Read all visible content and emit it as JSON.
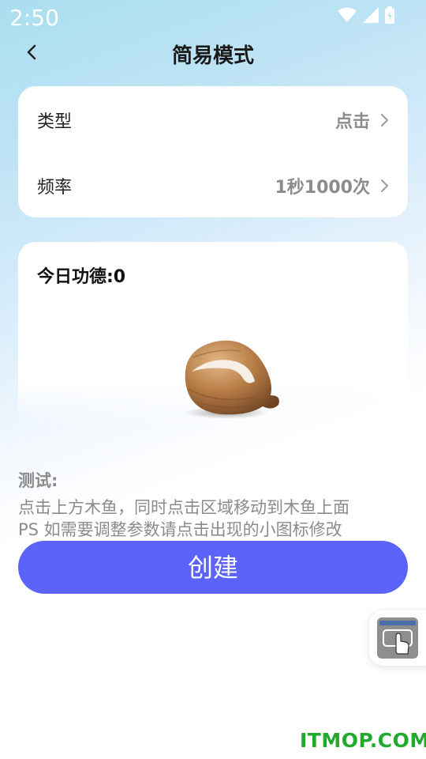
{
  "status_bar": {
    "time": "2:50",
    "icons": [
      "wifi-icon",
      "signal-icon",
      "battery-icon"
    ]
  },
  "navbar": {
    "title": "简易模式"
  },
  "settings": {
    "items": [
      {
        "label": "类型",
        "value": "点击"
      },
      {
        "label": "频率",
        "value": "1秒1000次"
      }
    ]
  },
  "merit": {
    "label": "今日功德:0"
  },
  "test": {
    "title": "测试:",
    "line1": "点击上方木鱼，同时点击区域移动到木鱼上面",
    "line2": "PS 如需要调整参数请点击出现的小图标修改"
  },
  "create_button": {
    "label": "创建"
  },
  "watermark": "ITMOP.COM",
  "colors": {
    "accent": "#5b63f8",
    "muted": "#8b8b8b",
    "watermark": "#22aa2e"
  }
}
